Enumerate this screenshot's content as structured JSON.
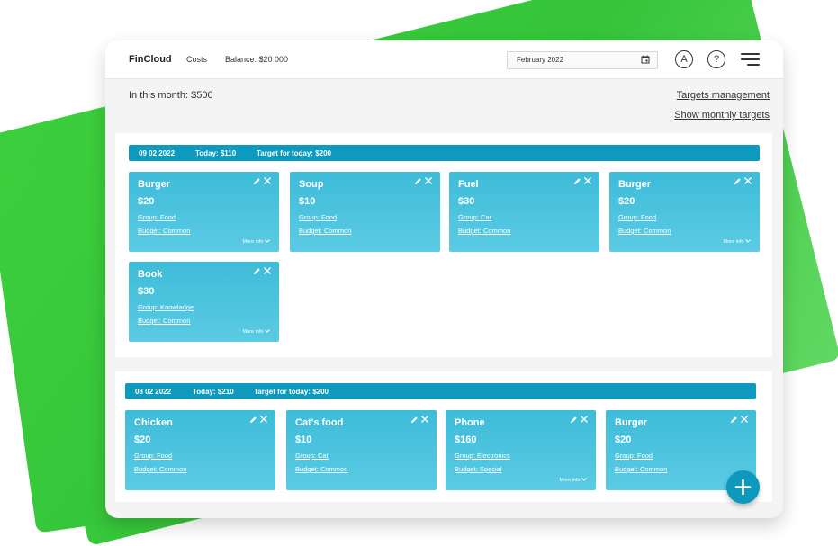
{
  "app": {
    "brand": "FinCloud",
    "nav_costs": "Costs",
    "balance": "Balance: $20 000",
    "date_value": "February 2022",
    "account_icon_glyph": "A",
    "help_icon_glyph": "?"
  },
  "summary": {
    "month_total": "In this month: $500",
    "targets_link": "Targets management",
    "monthly_targets_link": "Show monthly targets"
  },
  "days": [
    {
      "date": "09 02 2022",
      "today": "Today: $110",
      "target": "Target for today: $200",
      "cards": [
        {
          "name": "Burger",
          "amount": "$20",
          "group": "Group: Food",
          "budget": "Budget: Common",
          "more": "More info"
        },
        {
          "name": "Soup",
          "amount": "$10",
          "group": "Group: Food",
          "budget": "Budget: Common",
          "more": ""
        },
        {
          "name": "Fuel",
          "amount": "$30",
          "group": "Group: Car",
          "budget": "Budget: Common",
          "more": ""
        },
        {
          "name": "Burger",
          "amount": "$20",
          "group": "Group: Food",
          "budget": "Budget: Common",
          "more": "More info"
        },
        {
          "name": "Book",
          "amount": "$30",
          "group": "Group: Knowladge",
          "budget": "Budget: Common",
          "more": "More info"
        }
      ]
    },
    {
      "date": "08 02 2022",
      "today": "Today: $210",
      "target": "Target for today: $200",
      "cards": [
        {
          "name": "Chicken",
          "amount": "$20",
          "group": "Group: Food",
          "budget": "Budget: Common",
          "more": ""
        },
        {
          "name": "Cat's food",
          "amount": "$10",
          "group": "Group: Cat",
          "budget": "Budget: Common",
          "more": ""
        },
        {
          "name": "Phone",
          "amount": "$160",
          "group": "Group: Electronics",
          "budget": "Budget: Special",
          "more": "More info"
        },
        {
          "name": "Burger",
          "amount": "$20",
          "group": "Group: Food",
          "budget": "Budget: Common",
          "more": ""
        }
      ]
    }
  ],
  "icons": {
    "calendar": "calendar-icon",
    "account": "account-icon",
    "help": "help-icon",
    "menu": "menu-icon",
    "edit": "pencil-icon",
    "close": "close-icon",
    "add": "plus-icon",
    "chevron": "chevron-down-icon"
  },
  "colors": {
    "accent": "#0e9abe",
    "card": "#3dbcd9",
    "background_shape": "#3ccf3c"
  }
}
